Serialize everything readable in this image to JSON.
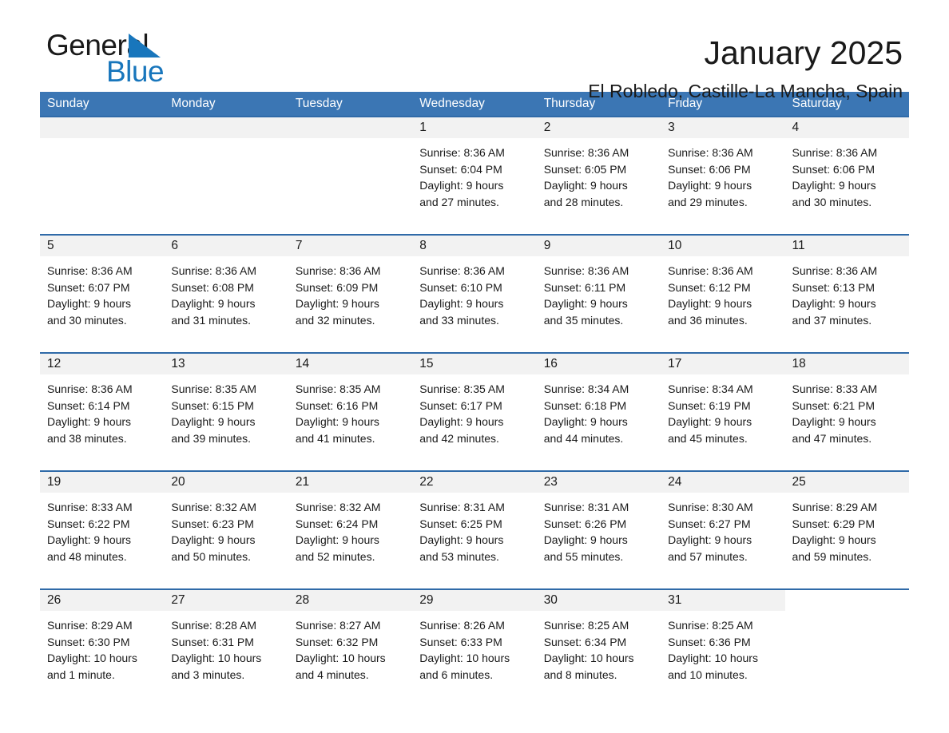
{
  "logo": {
    "word1": "General",
    "word2": "Blue",
    "accent_color": "#1876bc"
  },
  "header": {
    "title": "January 2025",
    "subtitle": "El Robledo, Castille-La Mancha, Spain"
  },
  "calendar": {
    "header_bg": "#3b76b4",
    "daynum_bg": "#f2f2f2",
    "rule_color": "#2f6aa8",
    "weekdays": [
      "Sunday",
      "Monday",
      "Tuesday",
      "Wednesday",
      "Thursday",
      "Friday",
      "Saturday"
    ],
    "weeks": [
      [
        {
          "day": "",
          "empty": true
        },
        {
          "day": "",
          "empty": true
        },
        {
          "day": "",
          "empty": true
        },
        {
          "day": "1",
          "sunrise": "Sunrise: 8:36 AM",
          "sunset": "Sunset: 6:04 PM",
          "daylight1": "Daylight: 9 hours",
          "daylight2": "and 27 minutes."
        },
        {
          "day": "2",
          "sunrise": "Sunrise: 8:36 AM",
          "sunset": "Sunset: 6:05 PM",
          "daylight1": "Daylight: 9 hours",
          "daylight2": "and 28 minutes."
        },
        {
          "day": "3",
          "sunrise": "Sunrise: 8:36 AM",
          "sunset": "Sunset: 6:06 PM",
          "daylight1": "Daylight: 9 hours",
          "daylight2": "and 29 minutes."
        },
        {
          "day": "4",
          "sunrise": "Sunrise: 8:36 AM",
          "sunset": "Sunset: 6:06 PM",
          "daylight1": "Daylight: 9 hours",
          "daylight2": "and 30 minutes."
        }
      ],
      [
        {
          "day": "5",
          "sunrise": "Sunrise: 8:36 AM",
          "sunset": "Sunset: 6:07 PM",
          "daylight1": "Daylight: 9 hours",
          "daylight2": "and 30 minutes."
        },
        {
          "day": "6",
          "sunrise": "Sunrise: 8:36 AM",
          "sunset": "Sunset: 6:08 PM",
          "daylight1": "Daylight: 9 hours",
          "daylight2": "and 31 minutes."
        },
        {
          "day": "7",
          "sunrise": "Sunrise: 8:36 AM",
          "sunset": "Sunset: 6:09 PM",
          "daylight1": "Daylight: 9 hours",
          "daylight2": "and 32 minutes."
        },
        {
          "day": "8",
          "sunrise": "Sunrise: 8:36 AM",
          "sunset": "Sunset: 6:10 PM",
          "daylight1": "Daylight: 9 hours",
          "daylight2": "and 33 minutes."
        },
        {
          "day": "9",
          "sunrise": "Sunrise: 8:36 AM",
          "sunset": "Sunset: 6:11 PM",
          "daylight1": "Daylight: 9 hours",
          "daylight2": "and 35 minutes."
        },
        {
          "day": "10",
          "sunrise": "Sunrise: 8:36 AM",
          "sunset": "Sunset: 6:12 PM",
          "daylight1": "Daylight: 9 hours",
          "daylight2": "and 36 minutes."
        },
        {
          "day": "11",
          "sunrise": "Sunrise: 8:36 AM",
          "sunset": "Sunset: 6:13 PM",
          "daylight1": "Daylight: 9 hours",
          "daylight2": "and 37 minutes."
        }
      ],
      [
        {
          "day": "12",
          "sunrise": "Sunrise: 8:36 AM",
          "sunset": "Sunset: 6:14 PM",
          "daylight1": "Daylight: 9 hours",
          "daylight2": "and 38 minutes."
        },
        {
          "day": "13",
          "sunrise": "Sunrise: 8:35 AM",
          "sunset": "Sunset: 6:15 PM",
          "daylight1": "Daylight: 9 hours",
          "daylight2": "and 39 minutes."
        },
        {
          "day": "14",
          "sunrise": "Sunrise: 8:35 AM",
          "sunset": "Sunset: 6:16 PM",
          "daylight1": "Daylight: 9 hours",
          "daylight2": "and 41 minutes."
        },
        {
          "day": "15",
          "sunrise": "Sunrise: 8:35 AM",
          "sunset": "Sunset: 6:17 PM",
          "daylight1": "Daylight: 9 hours",
          "daylight2": "and 42 minutes."
        },
        {
          "day": "16",
          "sunrise": "Sunrise: 8:34 AM",
          "sunset": "Sunset: 6:18 PM",
          "daylight1": "Daylight: 9 hours",
          "daylight2": "and 44 minutes."
        },
        {
          "day": "17",
          "sunrise": "Sunrise: 8:34 AM",
          "sunset": "Sunset: 6:19 PM",
          "daylight1": "Daylight: 9 hours",
          "daylight2": "and 45 minutes."
        },
        {
          "day": "18",
          "sunrise": "Sunrise: 8:33 AM",
          "sunset": "Sunset: 6:21 PM",
          "daylight1": "Daylight: 9 hours",
          "daylight2": "and 47 minutes."
        }
      ],
      [
        {
          "day": "19",
          "sunrise": "Sunrise: 8:33 AM",
          "sunset": "Sunset: 6:22 PM",
          "daylight1": "Daylight: 9 hours",
          "daylight2": "and 48 minutes."
        },
        {
          "day": "20",
          "sunrise": "Sunrise: 8:32 AM",
          "sunset": "Sunset: 6:23 PM",
          "daylight1": "Daylight: 9 hours",
          "daylight2": "and 50 minutes."
        },
        {
          "day": "21",
          "sunrise": "Sunrise: 8:32 AM",
          "sunset": "Sunset: 6:24 PM",
          "daylight1": "Daylight: 9 hours",
          "daylight2": "and 52 minutes."
        },
        {
          "day": "22",
          "sunrise": "Sunrise: 8:31 AM",
          "sunset": "Sunset: 6:25 PM",
          "daylight1": "Daylight: 9 hours",
          "daylight2": "and 53 minutes."
        },
        {
          "day": "23",
          "sunrise": "Sunrise: 8:31 AM",
          "sunset": "Sunset: 6:26 PM",
          "daylight1": "Daylight: 9 hours",
          "daylight2": "and 55 minutes."
        },
        {
          "day": "24",
          "sunrise": "Sunrise: 8:30 AM",
          "sunset": "Sunset: 6:27 PM",
          "daylight1": "Daylight: 9 hours",
          "daylight2": "and 57 minutes."
        },
        {
          "day": "25",
          "sunrise": "Sunrise: 8:29 AM",
          "sunset": "Sunset: 6:29 PM",
          "daylight1": "Daylight: 9 hours",
          "daylight2": "and 59 minutes."
        }
      ],
      [
        {
          "day": "26",
          "sunrise": "Sunrise: 8:29 AM",
          "sunset": "Sunset: 6:30 PM",
          "daylight1": "Daylight: 10 hours",
          "daylight2": "and 1 minute."
        },
        {
          "day": "27",
          "sunrise": "Sunrise: 8:28 AM",
          "sunset": "Sunset: 6:31 PM",
          "daylight1": "Daylight: 10 hours",
          "daylight2": "and 3 minutes."
        },
        {
          "day": "28",
          "sunrise": "Sunrise: 8:27 AM",
          "sunset": "Sunset: 6:32 PM",
          "daylight1": "Daylight: 10 hours",
          "daylight2": "and 4 minutes."
        },
        {
          "day": "29",
          "sunrise": "Sunrise: 8:26 AM",
          "sunset": "Sunset: 6:33 PM",
          "daylight1": "Daylight: 10 hours",
          "daylight2": "and 6 minutes."
        },
        {
          "day": "30",
          "sunrise": "Sunrise: 8:25 AM",
          "sunset": "Sunset: 6:34 PM",
          "daylight1": "Daylight: 10 hours",
          "daylight2": "and 8 minutes."
        },
        {
          "day": "31",
          "sunrise": "Sunrise: 8:25 AM",
          "sunset": "Sunset: 6:36 PM",
          "daylight1": "Daylight: 10 hours",
          "daylight2": "and 10 minutes."
        },
        {
          "day": "",
          "empty": true,
          "trailing": true
        }
      ]
    ]
  }
}
